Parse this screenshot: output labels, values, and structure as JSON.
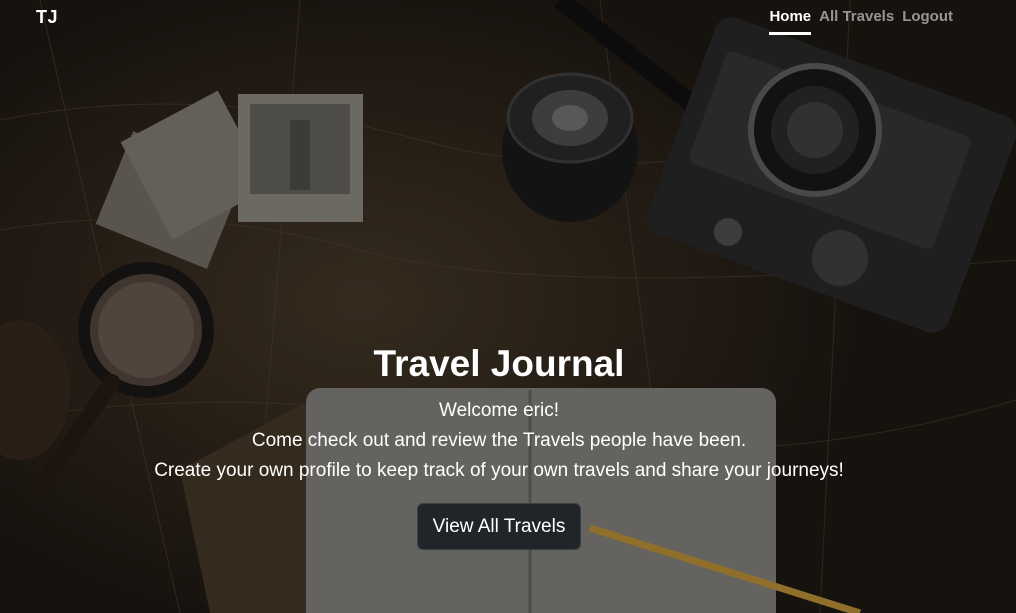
{
  "navbar": {
    "brand": "TJ",
    "links": [
      {
        "label": "Home",
        "active": true
      },
      {
        "label": "All Travels",
        "active": false
      },
      {
        "label": "Logout",
        "active": false
      }
    ]
  },
  "hero": {
    "title": "Travel Journal",
    "lines": [
      "Welcome eric!",
      "Come check out and review the Travels people have been.",
      "Create your own profile to keep track of your own travels and share your journeys!"
    ],
    "cta_label": "View All Travels",
    "background_description": "vintage map with camera, lens, postcards, magnifying glass and notebook"
  },
  "colors": {
    "button_bg": "#212529",
    "text": "#ffffff",
    "nav_inactive": "rgba(255,255,255,0.55)"
  }
}
